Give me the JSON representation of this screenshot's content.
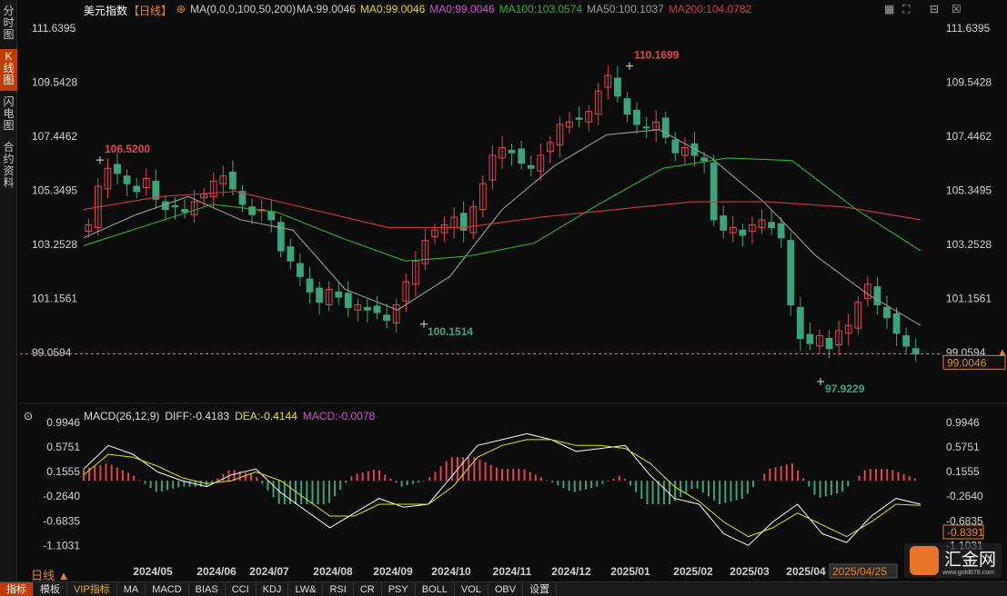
{
  "sidebar": {
    "items": [
      {
        "label": "分时图",
        "active": false
      },
      {
        "label": "K线图",
        "active": true
      },
      {
        "label": "闪电图",
        "active": false
      },
      {
        "label": "合约资料",
        "active": false
      }
    ]
  },
  "header": {
    "name": "美元指数",
    "period_tag": "【日线】",
    "ma_params": "MA(0,0,0,100,50,200)",
    "ma_main": "MA:99.0046",
    "ma0_a": "MA0:99.0046",
    "ma0_b": "MA0:99.0046",
    "ma100": "MA100:103.0574",
    "ma50": "MA50:100.1037",
    "ma200": "MA200:104.0782"
  },
  "macd_header": {
    "params": "MACD(26,12,9)",
    "diff": "DIFF:-0.4183",
    "dea": "DEA:-0.4144",
    "macd": "MACD:-0.0078"
  },
  "period_label": "日线 ▲",
  "date_tooltip": "2025/04/25",
  "tabs": [
    "指标",
    "模板",
    "VIP指标",
    "MA",
    "MACD",
    "BIAS",
    "CCI",
    "KDJ",
    "LW&",
    "RSI",
    "CR",
    "PSY",
    "BOLL",
    "VOL",
    "OBV",
    "设置"
  ],
  "logo": {
    "text": "汇金网",
    "sub": "www.gold678.com"
  },
  "colors": {
    "up": "#e8424a",
    "down": "#3aa57a",
    "ma50": "#9a9a9a",
    "ma100": "#26b526",
    "ma200": "#d63535",
    "diff": "#ffffff",
    "dea": "#e6e600",
    "accent": "#e6822a"
  },
  "chart_data": [
    {
      "type": "candlestick",
      "title": "美元指数 日线",
      "y_ticks": [
        111.6395,
        109.5428,
        107.4462,
        105.3495,
        103.2528,
        101.1561,
        99.0594
      ],
      "ylim": [
        97.5,
        112.2
      ],
      "x_labels": [
        "2024/05",
        "2024/06",
        "2024/07",
        "2024/08",
        "2024/09",
        "2024/10",
        "2024/11",
        "2024/12",
        "2025/01",
        "2025/02",
        "2025/03",
        "2025/04"
      ],
      "current_price": 99.0046,
      "current_price_label": "99.0046",
      "annotations": [
        {
          "label": "106.5200",
          "value": 106.52,
          "date": "2024/04"
        },
        {
          "label": "110.1699",
          "value": 110.1699,
          "date": "2025/01"
        },
        {
          "label": "100.1514",
          "value": 100.1514,
          "date": "2024/09"
        },
        {
          "label": "97.9229",
          "value": 97.9229,
          "date": "2025/04"
        }
      ],
      "close_approx": [
        104.0,
        105.5,
        106.2,
        106.0,
        105.6,
        105.3,
        105.8,
        105.0,
        104.6,
        104.7,
        104.5,
        104.9,
        105.2,
        105.7,
        105.9,
        105.4,
        104.8,
        104.4,
        104.6,
        104.2,
        103.0,
        102.6,
        102.0,
        101.4,
        101.0,
        101.5,
        101.2,
        100.8,
        100.9,
        100.7,
        100.6,
        100.3,
        100.9,
        101.8,
        102.6,
        103.4,
        103.8,
        104.0,
        104.3,
        103.8,
        104.7,
        105.6,
        106.7,
        107.0,
        106.8,
        106.4,
        106.2,
        106.7,
        107.2,
        107.9,
        108.0,
        108.1,
        108.4,
        109.2,
        109.8,
        109.0,
        108.3,
        107.9,
        107.8,
        108.0,
        107.4,
        106.8,
        107.0,
        106.7,
        106.5,
        104.2,
        103.8,
        103.9,
        103.6,
        104.0,
        104.2,
        103.9,
        103.5,
        100.9,
        99.6,
        99.4,
        99.7,
        99.2,
        99.9,
        100.1,
        101.0,
        101.7,
        100.9,
        100.4,
        99.8,
        99.3,
        99.0
      ],
      "ma50_approx": [
        103.5,
        104.4,
        105.1,
        104.2,
        103.8,
        101.5,
        100.7,
        102.0,
        104.6,
        106.3,
        107.5,
        107.7,
        106.6,
        104.9,
        102.8,
        101.3,
        100.1
      ],
      "ma100_approx": [
        103.2,
        104.0,
        104.8,
        104.5,
        103.5,
        102.6,
        102.8,
        103.3,
        104.8,
        106.2,
        106.6,
        106.5,
        104.6,
        103.0
      ],
      "ma200_approx": [
        104.6,
        105.1,
        105.3,
        104.6,
        103.9,
        103.9,
        104.3,
        104.6,
        104.9,
        104.9,
        104.7,
        104.2
      ]
    },
    {
      "type": "bar",
      "title": "MACD(26,12,9)",
      "y_ticks": [
        0.9946,
        0.5751,
        0.1555,
        -0.264,
        -0.6835,
        -1.1031
      ],
      "ylim": [
        -1.25,
        1.1
      ],
      "current_label": "-0.8391",
      "diff_approx": [
        0.2,
        0.6,
        0.45,
        0.15,
        0.0,
        -0.1,
        0.1,
        0.2,
        -0.2,
        -0.5,
        -0.8,
        -0.55,
        -0.3,
        -0.45,
        -0.4,
        0.1,
        0.6,
        0.7,
        0.8,
        0.7,
        0.5,
        0.55,
        0.6,
        0.1,
        -0.3,
        -0.4,
        -0.9,
        -1.1,
        -0.7,
        -0.4,
        -0.9,
        -1.05,
        -0.6,
        -0.3,
        -0.4
      ],
      "dea_approx": [
        0.1,
        0.45,
        0.4,
        0.25,
        0.05,
        -0.05,
        0.0,
        0.15,
        0.0,
        -0.3,
        -0.6,
        -0.6,
        -0.4,
        -0.4,
        -0.4,
        -0.1,
        0.4,
        0.6,
        0.7,
        0.7,
        0.6,
        0.6,
        0.55,
        0.3,
        -0.1,
        -0.35,
        -0.7,
        -0.95,
        -0.8,
        -0.55,
        -0.75,
        -0.95,
        -0.7,
        -0.4,
        -0.42
      ]
    }
  ]
}
